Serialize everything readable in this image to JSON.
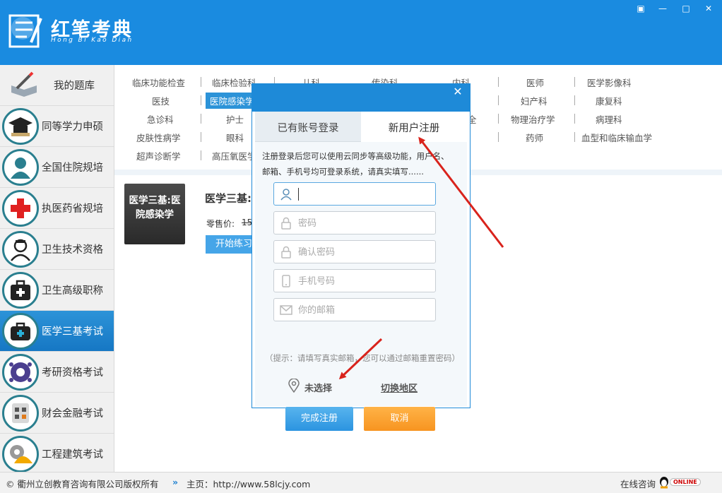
{
  "app": {
    "title_cn": "红笔考典",
    "title_en": "Hong Bi Kao Dian",
    "colors": {
      "header_blue": "#1a8be0",
      "accent_orange": "#f79420",
      "arrow_red": "#d9231c"
    }
  },
  "window_controls": {
    "menu": "▣",
    "minimize": "—",
    "maximize": "□",
    "close": "✕"
  },
  "sidebar": {
    "items": [
      {
        "label": "我的题库",
        "icon": "pencil-book-icon"
      },
      {
        "label": "同等学力申硕",
        "icon": "graduation-cap-icon"
      },
      {
        "label": "全国住院规培",
        "icon": "doctor-icon"
      },
      {
        "label": "执医药省规培",
        "icon": "red-cross-icon"
      },
      {
        "label": "卫生技术资格",
        "icon": "nurse-icon"
      },
      {
        "label": "卫生高级职称",
        "icon": "medical-kit-icon"
      },
      {
        "label": "医学三基考试",
        "icon": "medical-bag-icon",
        "active": true
      },
      {
        "label": "考研资格考试",
        "icon": "gear-people-icon"
      },
      {
        "label": "财会金融考试",
        "icon": "calculator-icon"
      },
      {
        "label": "工程建筑考试",
        "icon": "helmet-gear-icon"
      }
    ]
  },
  "categories": {
    "row1": [
      "临床功能检查",
      "临床检验科",
      "儿科",
      "传染科",
      "内科",
      "医师",
      "医学影像科"
    ],
    "row2": [
      "医技",
      "医院感染学",
      "妇产科",
      "康复科"
    ],
    "row3": [
      "急诊科",
      "护士",
      "全",
      "物理治疗学",
      "病理科"
    ],
    "row4": [
      "皮肤性病学",
      "眼科",
      "药师",
      "血型和临床输血学"
    ],
    "row5": [
      "超声诊断学",
      "高压氧医学"
    ],
    "selected": "医院感染学"
  },
  "book": {
    "cover_line1": "医学三基:医",
    "cover_line2": "院感染学",
    "title": "医学三基:",
    "price_label": "零售价:",
    "price_value": "15",
    "start_button": "开始练习"
  },
  "dialog": {
    "close": "✕",
    "tab_login": "已有账号登录",
    "tab_register": "新用户注册",
    "notice_line1": "注册登录后您可以使用云同步等高级功能，用户名、",
    "notice_line2": "邮箱、手机号均可登录系统，请真实填写......",
    "fields": {
      "username": {
        "value": "",
        "placeholder": ""
      },
      "password": {
        "placeholder": "密码"
      },
      "confirm_password": {
        "placeholder": "确认密码"
      },
      "phone": {
        "placeholder": "手机号码"
      },
      "email": {
        "placeholder": "你的邮箱"
      }
    },
    "hint": "（提示：请填写真实邮箱，您可以通过邮箱重置密码）",
    "location_value": "未选择",
    "location_switch": "切换地区",
    "submit": "完成注册",
    "cancel": "取消"
  },
  "footer": {
    "copyright": "© 衢州立创教育咨询有限公司版权所有",
    "home_prefix": "»",
    "home_label": "主页：http://www.58lcjy.com",
    "online_consult": "在线咨询",
    "online_badge": "ONLINE"
  }
}
